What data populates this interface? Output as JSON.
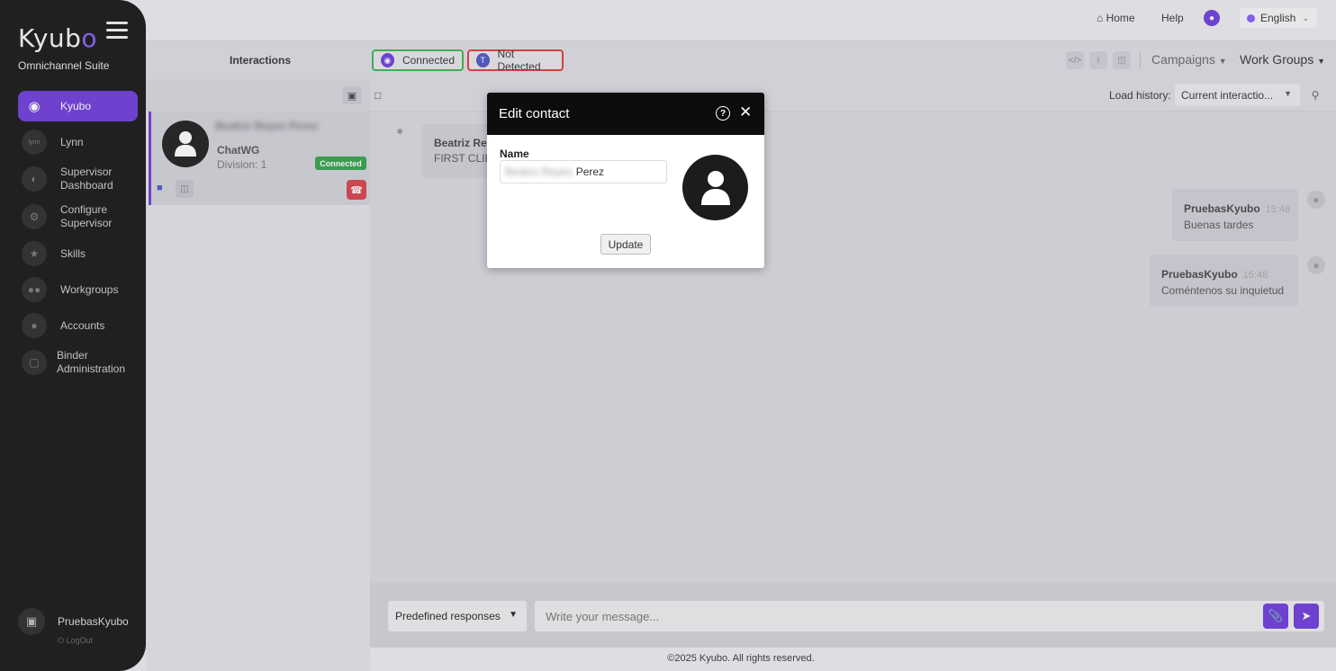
{
  "brand": {
    "logo_text": "Kyub",
    "logo_accent": "o",
    "suite": "Omnichannel Suite",
    "accent_color": "#6d3bd9"
  },
  "sidebar": {
    "items": [
      {
        "label": "Kyubo",
        "icon": "kyubo-logo-icon",
        "active": true
      },
      {
        "label": "Lynn",
        "icon": "lynn-icon"
      },
      {
        "label": "Supervisor Dashboard",
        "icon": "dashboard-icon"
      },
      {
        "label": "Configure Supervisor",
        "icon": "user-gear-icon"
      },
      {
        "label": "Skills",
        "icon": "skills-icon"
      },
      {
        "label": "Workgroups",
        "icon": "users-icon"
      },
      {
        "label": "Accounts",
        "icon": "accounts-icon"
      },
      {
        "label": "Binder Administration",
        "icon": "binder-icon"
      }
    ],
    "user": {
      "name": "PruebasKyubo",
      "logout": "LogOut"
    }
  },
  "topbar": {
    "home": "Home",
    "help": "Help",
    "language": "English"
  },
  "header": {
    "title": "Interactions",
    "status_connected": "Connected",
    "status_not_detected": "Not Detected",
    "campaigns": "Campaigns",
    "work_groups": "Work Groups"
  },
  "interaction_card": {
    "name": "Beatriz Reyes Perez",
    "channel": "ChatWG",
    "division": "Division: 1",
    "status": "Connected"
  },
  "chat": {
    "load_history_label": "Load history:",
    "history_value": "Current interactio...",
    "incoming": {
      "sender": "Beatriz Rey",
      "text": "FIRST CLIE"
    },
    "outgoing": [
      {
        "sender": "PruebasKyubo",
        "time": "15:48",
        "text": "Buenas tardes"
      },
      {
        "sender": "PruebasKyubo",
        "time": "15:48",
        "text": "Coméntenos su inquietud"
      }
    ]
  },
  "composer": {
    "predefined": "Predefined responses",
    "placeholder": "Write your message..."
  },
  "footer": "©2025 Kyubo. All rights reserved.",
  "modal": {
    "title": "Edit contact",
    "name_label": "Name",
    "name_blurred": "Beatriz Reyes",
    "name_visible": "Perez",
    "update": "Update"
  }
}
